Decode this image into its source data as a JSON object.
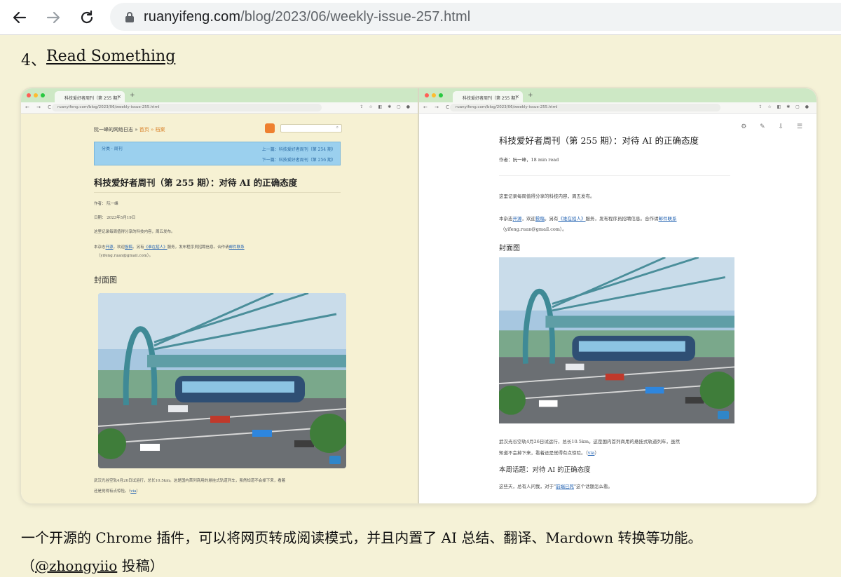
{
  "browser": {
    "url_domain": "ruanyifeng.com",
    "url_path": "/blog/2023/06/weekly-issue-257.html"
  },
  "article": {
    "section_number": "4、",
    "section_title": "Read Something",
    "desc_line1": "一个开源的 Chrome 插件，可以将网页转成阅读模式，并且内置了 AI 总结、翻译、Mardown 转换等功能。",
    "desc_prefix": "（",
    "desc_link": "@zhongyiio",
    "desc_suffix": " 投稿）"
  },
  "screenshot": {
    "tab_title": "科技爱好者周刊（第 255 期）",
    "tab_close": "×",
    "tab_plus": "+",
    "nav_arrows": "← → C",
    "url": "ruanyifeng.com/blog/2023/06/weekly-issue-255.html",
    "toolbar_icons": "⇪ ☆ ◧ ✱ ▢ ●",
    "left": {
      "site_nav_a": "阮一峰的网络日志 » ",
      "site_nav_b": "首页 » 档案",
      "search_icon": "⌕",
      "category_text": "分类 · 周刊",
      "prev_link": "上一篇：科技爱好者周刊（第 254 期）",
      "next_link": "下一篇：科技爱好者周刊（第 256 期）",
      "title": "科技爱好者周刊（第 255 期）：对待 AI 的正确态度",
      "author": "作者： 阮一峰",
      "date": "日期： 2023年5月19日",
      "intro": "这里记录每周值得分享的科技内容，周五发布。",
      "open_a": "本杂志",
      "open_link1": "开源",
      "open_b": "，欢迎",
      "open_link2": "投稿",
      "open_c": "。另有",
      "open_link3": "《谁在招人》",
      "open_d": "服务，发布程序员招聘信息。合作请",
      "open_link4": "邮件联系",
      "email": "（yifeng.ruan@gmail.com）。",
      "cover_heading": "封面图",
      "caption_line1": "武汉光谷空轨4月26日试运行，总长10.5km。这是国内首列商用的悬挂式轨道列车，虽然知道不会掉下来，看着",
      "caption_line2": "还是觉得有点惊险。（",
      "caption_link": "via",
      "caption_end": "）"
    },
    "right": {
      "reader_icons": "⚙ ✎ ⇩ ☰",
      "title": "科技爱好者周刊（第 255 期）：对待 AI 的正确态度",
      "author": "作者：阮一峰，18 min read",
      "intro": "这里记录每周值得分享的科技内容，周五发布。",
      "open_a": "本杂志",
      "open_link1": "开源",
      "open_b": "，欢迎",
      "open_link2": "投稿",
      "open_c": "。另有",
      "open_link3": "《谁在招人》",
      "open_d": "服务，发布程序员招聘信息。合作请",
      "open_link4": "邮件联系",
      "email": "（yifeng.ruan@gmail.com）。",
      "cover_heading": "封面图",
      "caption_line1": "武汉光谷空轨4月26日试运行，总长10.5km。这是国内首列商用的悬挂式轨道列车，虽然",
      "caption_line2": "知道不会掉下来，看着还是觉得有点惊险。（",
      "caption_link": "via",
      "caption_end": "）",
      "topic_heading": "本周话题：对待 AI 的正确态度",
      "topic_a": "这些天，总有人问我，对于\"",
      "topic_link": "前端已死",
      "topic_b": "\"这个话题怎么看。"
    }
  },
  "colors": {
    "page_bg": "#f5f2d7",
    "link": "#1e5fb0",
    "tab_strip": "#cde8c5",
    "rss": "#ee802f",
    "notice_box": "#9bd0ee"
  }
}
